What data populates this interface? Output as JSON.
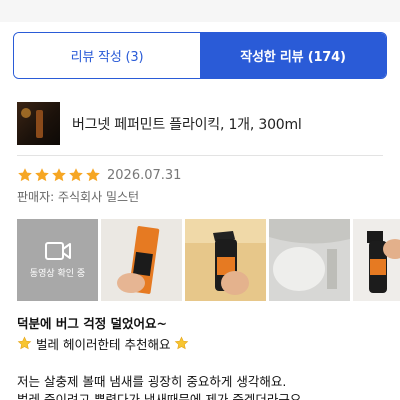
{
  "tabs": {
    "write_review": "리뷰 작성 (3)",
    "written_reviews": "작성한 리뷰 (174)"
  },
  "product": {
    "name": "버그넷 페퍼민트 플라이킥, 1개, 300ml",
    "thumb_icon": "product-thumbnail"
  },
  "review": {
    "stars": 5,
    "date": "2026.07.31",
    "seller": "판매자: 주식회사 밀스턴",
    "video_label": "동영상 확인 중",
    "title": "덕분에 버그 걱정 덜었어요~",
    "subtitle": "벌레 헤이러한테 추천해요",
    "body_line1": "저는 살충제 볼때 냄새를 굉장히 중요하게 생각해요.",
    "body_line2": "벌레 죽이려고 뿌렸다가 냄새때문에 제가 죽겠더라구요."
  },
  "colors": {
    "accent": "#2a5bd7",
    "star": "#f6a623",
    "video_bg": "#a8a8a8"
  }
}
